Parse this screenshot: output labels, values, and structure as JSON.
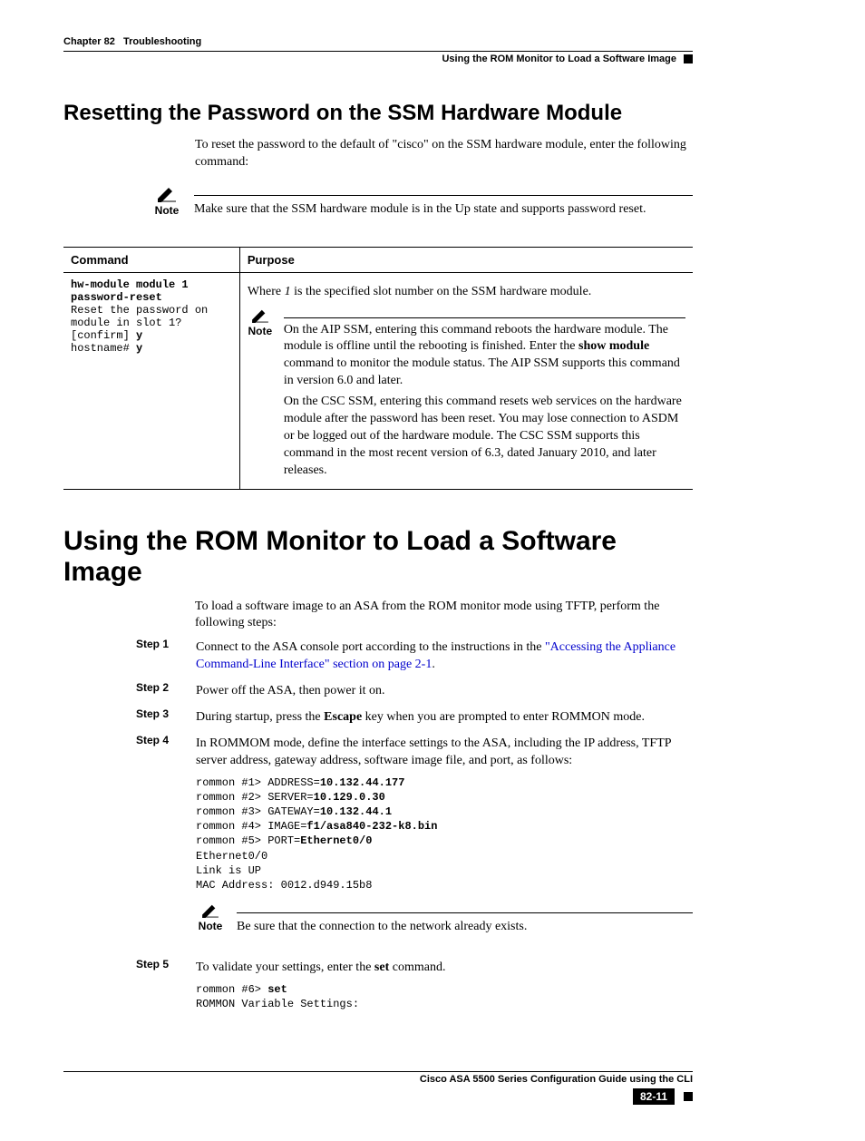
{
  "header": {
    "chapter_label": "Chapter 82",
    "chapter_title": "Troubleshooting",
    "section_title": "Using the ROM Monitor to Load a Software Image"
  },
  "section1": {
    "heading": "Resetting the Password on the SSM Hardware Module",
    "intro": "To reset the password to the default of \"cisco\" on the SSM hardware module, enter the following command:",
    "note_label": "Note",
    "note_text": "Make sure that the SSM hardware module is in the Up state and supports password reset.",
    "table": {
      "col1": "Command",
      "col2": "Purpose",
      "cmd_line1": "hw-module module 1 password-reset",
      "cmd_line2": "Reset the password on module in slot 1? [confirm] ",
      "cmd_line2_bold": "y",
      "cmd_line3_pre": "hostname# ",
      "cmd_line3_bold": "y",
      "purpose_pre": "Where ",
      "purpose_ital": "1",
      "purpose_post": " is the specified slot number on the SSM hardware module.",
      "inner_note_label": "Note",
      "inner_p1_pre": "On the AIP SSM, entering this command reboots the hardware module. The module is offline until the rebooting is finished. Enter the ",
      "inner_p1_bold": "show module",
      "inner_p1_post": " command to monitor the module status. The AIP SSM supports this command in version 6.0 and later.",
      "inner_p2": "On the CSC SSM, entering this command resets web services on the hardware module after the password has been reset. You may lose connection to ASDM or be logged out of the hardware module. The CSC SSM supports this command in the most recent version of 6.3, dated January 2010, and later releases."
    }
  },
  "section2": {
    "heading": "Using the ROM Monitor to Load a Software Image",
    "intro": "To load a software image to an ASA from the ROM monitor mode using TFTP, perform the following steps:",
    "steps": {
      "s1": {
        "label": "Step 1",
        "pre": "Connect to the ASA console port according to the instructions in the ",
        "link": "\"Accessing the Appliance Command-Line Interface\" section on page 2-1",
        "post": "."
      },
      "s2": {
        "label": "Step 2",
        "text": "Power off the ASA, then power it on."
      },
      "s3": {
        "label": "Step 3",
        "pre": "During startup, press the ",
        "bold": "Escape",
        "post": " key when you are prompted to enter ROMMON mode."
      },
      "s4": {
        "label": "Step 4",
        "text": "In ROMMOM mode, define the interface settings to the ASA, including the IP address, TFTP server address, gateway address, software image file, and port, as follows:",
        "code_l1_pre": "rommon #1> ADDRESS=",
        "code_l1_b": "10.132.44.177",
        "code_l2_pre": "rommon #2> SERVER=",
        "code_l2_b": "10.129.0.30",
        "code_l3_pre": "rommon #3> GATEWAY=",
        "code_l3_b": "10.132.44.1",
        "code_l4_pre": "rommon #4> IMAGE=",
        "code_l4_b": "f1/asa840-232-k8.bin",
        "code_l5_pre": "rommon #5> PORT=",
        "code_l5_b": "Ethernet0/0",
        "code_l6": "Ethernet0/0",
        "code_l7": "Link is UP",
        "code_l8": "MAC Address: 0012.d949.15b8",
        "note_label": "Note",
        "note_text": "Be sure that the connection to the network already exists."
      },
      "s5": {
        "label": "Step 5",
        "pre": "To validate your settings, enter the ",
        "bold": "set",
        "post": " command.",
        "code_l1_pre": "rommon #6> ",
        "code_l1_b": "set",
        "code_l2": "ROMMON Variable Settings:"
      }
    }
  },
  "footer": {
    "title": "Cisco ASA 5500 Series Configuration Guide using the CLI",
    "page": "82-11"
  }
}
